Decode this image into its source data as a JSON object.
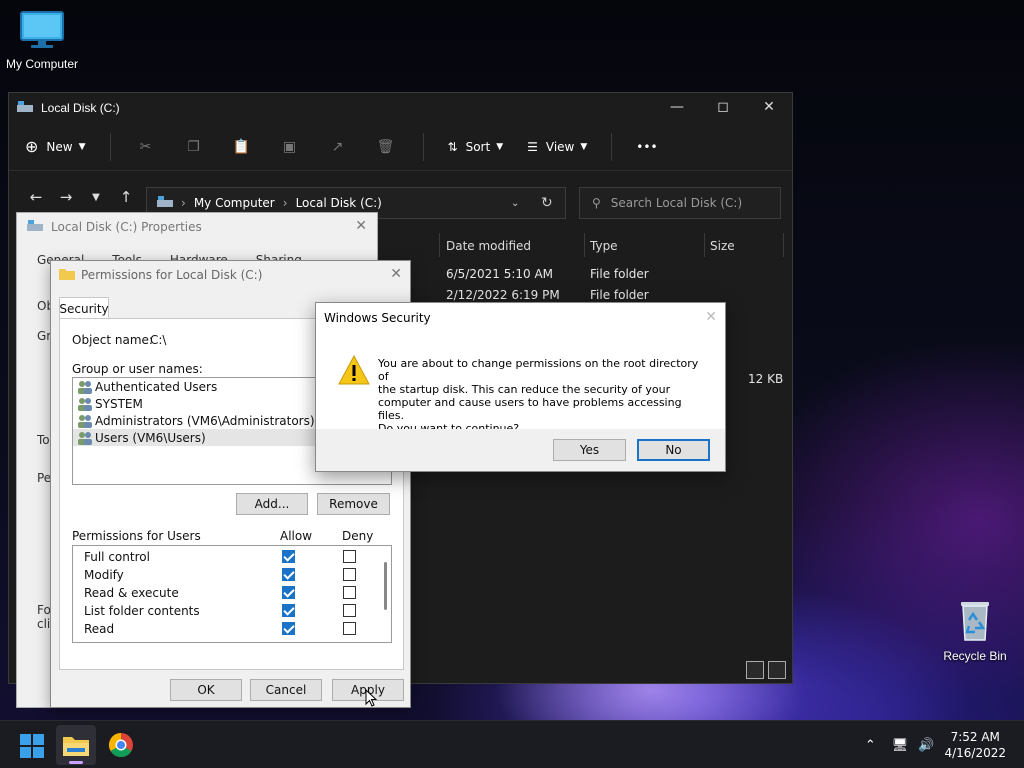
{
  "desktop": {
    "icons": [
      {
        "label": "My Computer",
        "icon": "monitor-icon"
      },
      {
        "label": "Recycle Bin",
        "icon": "recycle-bin-icon"
      }
    ]
  },
  "explorer": {
    "title": "Local Disk (C:)",
    "toolbar": {
      "new_label": "New",
      "sort_label": "Sort",
      "view_label": "View",
      "more_label": "•••"
    },
    "breadcrumb": [
      "My Computer",
      "Local Disk (C:)"
    ],
    "search_placeholder": "Search Local Disk (C:)",
    "columns": [
      "Date modified",
      "Type",
      "Size"
    ],
    "rows": [
      {
        "date": "6/5/2021 5:10 AM",
        "type": "File folder",
        "size": ""
      },
      {
        "date": "2/12/2022 6:19 PM",
        "type": "File folder",
        "size": ""
      },
      {
        "date": "",
        "type": "",
        "size": "12 KB"
      }
    ]
  },
  "properties": {
    "title": "Local Disk (C:) Properties",
    "tabs": [
      "General",
      "Tools",
      "Hardware",
      "Sharing"
    ],
    "fragments": [
      "Ob",
      "Gr",
      "To",
      "Pe",
      "Fo",
      "clic"
    ]
  },
  "permissions": {
    "title": "Permissions for Local Disk (C:)",
    "tab": "Security",
    "object_label": "Object name:",
    "object_value": "C:\\",
    "group_label": "Group or user names:",
    "users": [
      "Authenticated Users",
      "SYSTEM",
      "Administrators (VM6\\Administrators)",
      "Users (VM6\\Users)"
    ],
    "add_label": "Add...",
    "remove_label": "Remove",
    "perms_label": "Permissions for Users",
    "allow_label": "Allow",
    "deny_label": "Deny",
    "perms": [
      {
        "name": "Full control",
        "allow": true,
        "deny": false
      },
      {
        "name": "Modify",
        "allow": true,
        "deny": false
      },
      {
        "name": "Read & execute",
        "allow": true,
        "deny": false
      },
      {
        "name": "List folder contents",
        "allow": true,
        "deny": false
      },
      {
        "name": "Read",
        "allow": true,
        "deny": false
      }
    ],
    "ok_label": "OK",
    "cancel_label": "Cancel",
    "apply_label": "Apply"
  },
  "security": {
    "title": "Windows Security",
    "lines": [
      "You are about to change permissions on the root directory of",
      "the startup disk. This can reduce the security of your",
      "computer and cause users to have problems accessing files.",
      "Do you want to continue?"
    ],
    "yes_label": "Yes",
    "no_label": "No"
  },
  "taskbar": {
    "time": "7:52 AM",
    "date": "4/16/2022"
  }
}
